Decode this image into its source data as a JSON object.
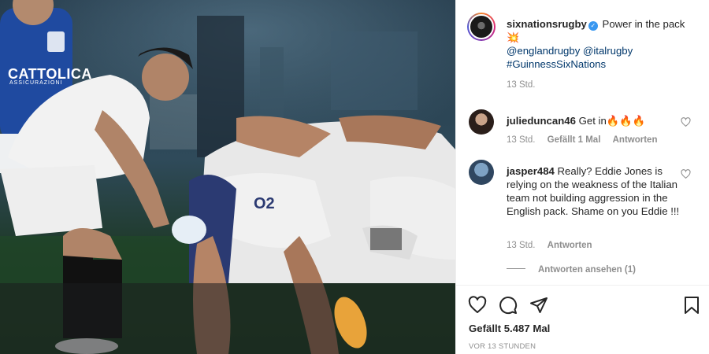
{
  "post": {
    "username": "sixnationsrugby",
    "caption": "Power in the pack",
    "caption_emoji": "💥",
    "mention1": "@englandrugby",
    "mention2": "@italrugby",
    "hashtag": "#GuinnessSixNations",
    "time": "13 Std."
  },
  "photo": {
    "jersey_sponsor": "CATTOLICA",
    "jersey_sponsor_sub": "ASSICURAZIONI",
    "shorts_sponsor": "O2"
  },
  "comments": [
    {
      "username": "julieduncan46",
      "text": "Get in",
      "emoji": "🔥🔥🔥",
      "time": "13 Std.",
      "likes": "Gefällt 1 Mal",
      "reply": "Antworten"
    },
    {
      "username": "jasper484",
      "text": "Really? Eddie Jones is relying on the weakness of the Italian team not building aggression in the English pack. Shame on you Eddie !!!",
      "time": "13 Std.",
      "reply": "Antworten",
      "view_replies": "Antworten ansehen (1)"
    }
  ],
  "footer": {
    "likes": "Gefällt 5.487 Mal",
    "timestamp": "VOR 13 STUNDEN"
  },
  "colors": {
    "link": "#00376b",
    "secondary": "#8e8e8e",
    "verified": "#3897f0"
  }
}
